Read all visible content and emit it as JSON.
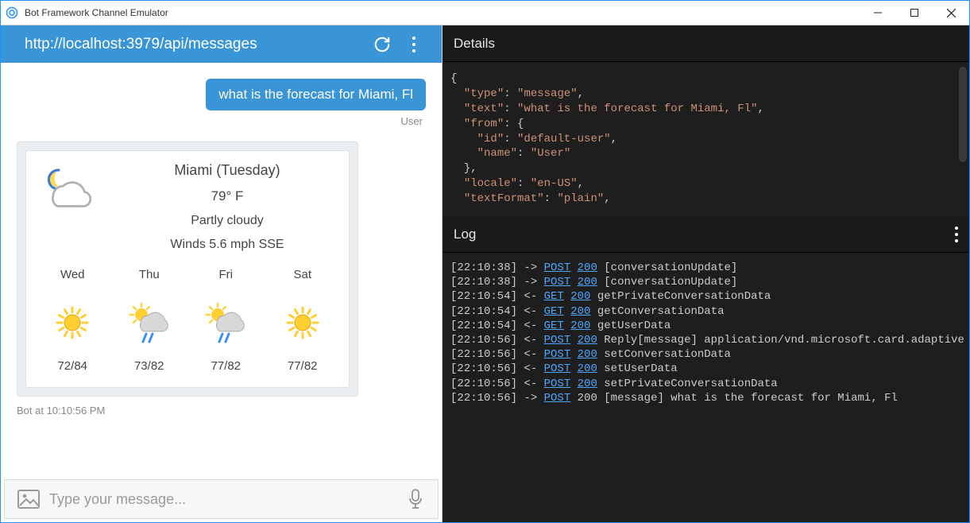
{
  "window": {
    "title": "Bot Framework Channel Emulator"
  },
  "address_bar": {
    "url": "http://localhost:3979/api/messages"
  },
  "chat": {
    "user_message": "what is the forecast for Miami, Fl",
    "user_sender": "User",
    "bot_timestamp": "Bot at 10:10:56 PM"
  },
  "weather_card": {
    "location": "Miami (Tuesday)",
    "temperature": "79° F",
    "condition": "Partly cloudy",
    "wind": "Winds 5.6 mph SSE",
    "forecast": [
      {
        "day": "Wed",
        "range": "72/84",
        "icon": "sunny"
      },
      {
        "day": "Thu",
        "range": "73/82",
        "icon": "rain-sun"
      },
      {
        "day": "Fri",
        "range": "77/82",
        "icon": "rain-sun"
      },
      {
        "day": "Sat",
        "range": "77/82",
        "icon": "sunny"
      }
    ]
  },
  "details": {
    "title": "Details",
    "json_lines": [
      {
        "indent": 0,
        "raw": "{"
      },
      {
        "indent": 1,
        "key": "type",
        "value": "message",
        "comma": true
      },
      {
        "indent": 1,
        "key": "text",
        "value": "what is the forecast for Miami, Fl",
        "comma": true
      },
      {
        "indent": 1,
        "key": "from",
        "open": "{"
      },
      {
        "indent": 2,
        "key": "id",
        "value": "default-user",
        "comma": true
      },
      {
        "indent": 2,
        "key": "name",
        "value": "User"
      },
      {
        "indent": 1,
        "raw": "},"
      },
      {
        "indent": 1,
        "key": "locale",
        "value": "en-US",
        "comma": true
      },
      {
        "indent": 1,
        "key": "textFormat",
        "value": "plain",
        "comma": true
      }
    ]
  },
  "log": {
    "title": "Log",
    "entries": [
      {
        "ts": "[22:10:38]",
        "dir": "->",
        "method": "POST",
        "code": "200",
        "rest": "[conversationUpdate]"
      },
      {
        "ts": "[22:10:38]",
        "dir": "->",
        "method": "POST",
        "code": "200",
        "rest": "[conversationUpdate]"
      },
      {
        "ts": "[22:10:54]",
        "dir": "<-",
        "method": "GET",
        "code": "200",
        "rest": "getPrivateConversationData"
      },
      {
        "ts": "[22:10:54]",
        "dir": "<-",
        "method": "GET",
        "code": "200",
        "rest": "getConversationData"
      },
      {
        "ts": "[22:10:54]",
        "dir": "<-",
        "method": "GET",
        "code": "200",
        "rest": "getUserData"
      },
      {
        "ts": "[22:10:56]",
        "dir": "<-",
        "method": "POST",
        "code": "200",
        "rest": "Reply[message] application/vnd.microsoft.card.adaptive"
      },
      {
        "ts": "[22:10:56]",
        "dir": "<-",
        "method": "POST",
        "code": "200",
        "rest": "setConversationData"
      },
      {
        "ts": "[22:10:56]",
        "dir": "<-",
        "method": "POST",
        "code": "200",
        "rest": "setUserData"
      },
      {
        "ts": "[22:10:56]",
        "dir": "<-",
        "method": "POST",
        "code": "200",
        "rest": "setPrivateConversationData"
      },
      {
        "ts": "[22:10:56]",
        "dir": "->",
        "method": "POST",
        "code": "200",
        "code_plain": true,
        "rest": "[message] what is the forecast for Miami, Fl"
      }
    ]
  },
  "compose": {
    "placeholder": "Type your message..."
  }
}
